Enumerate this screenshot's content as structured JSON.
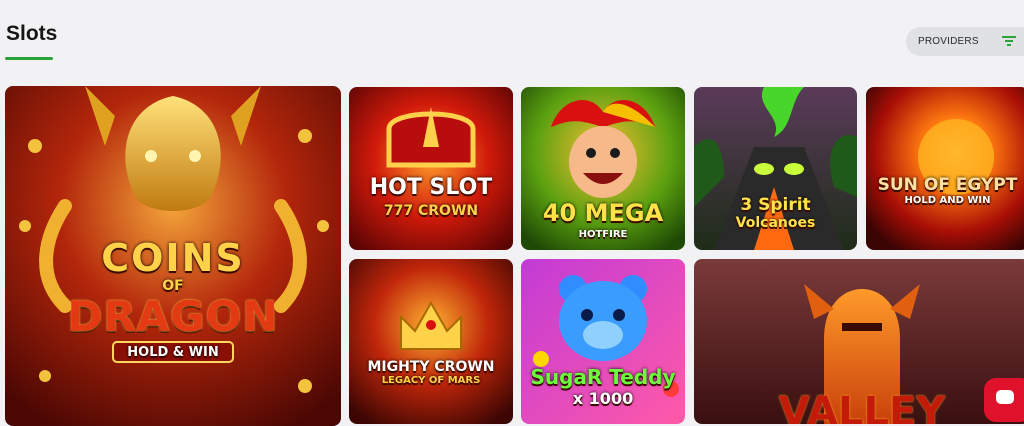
{
  "section": {
    "title": "Slots"
  },
  "filter": {
    "label": "PROVIDERS",
    "icon": "filter-icon"
  },
  "games": [
    {
      "line1": "COINS",
      "line2": "OF",
      "line3": "DRAGON",
      "badge": "HOLD & WIN"
    },
    {
      "line1": "HOT SLOT",
      "line2": "777 CROWN"
    },
    {
      "line1": "40 MEGA",
      "line2": "HOTFIRE"
    },
    {
      "line1": "3 Spirit",
      "line2": "Volcanoes"
    },
    {
      "line1": "SUN OF EGYPT",
      "line2": "HOLD AND WIN"
    },
    {
      "line1": "MIGHTY CROWN",
      "line2": "LEGACY OF MARS"
    },
    {
      "line1": "SugaR Teddy",
      "line2": "x 1000"
    },
    {
      "line1": "VALLEY"
    }
  ],
  "colors": {
    "accent": "#2aa43a",
    "chat": "#e0112a"
  }
}
